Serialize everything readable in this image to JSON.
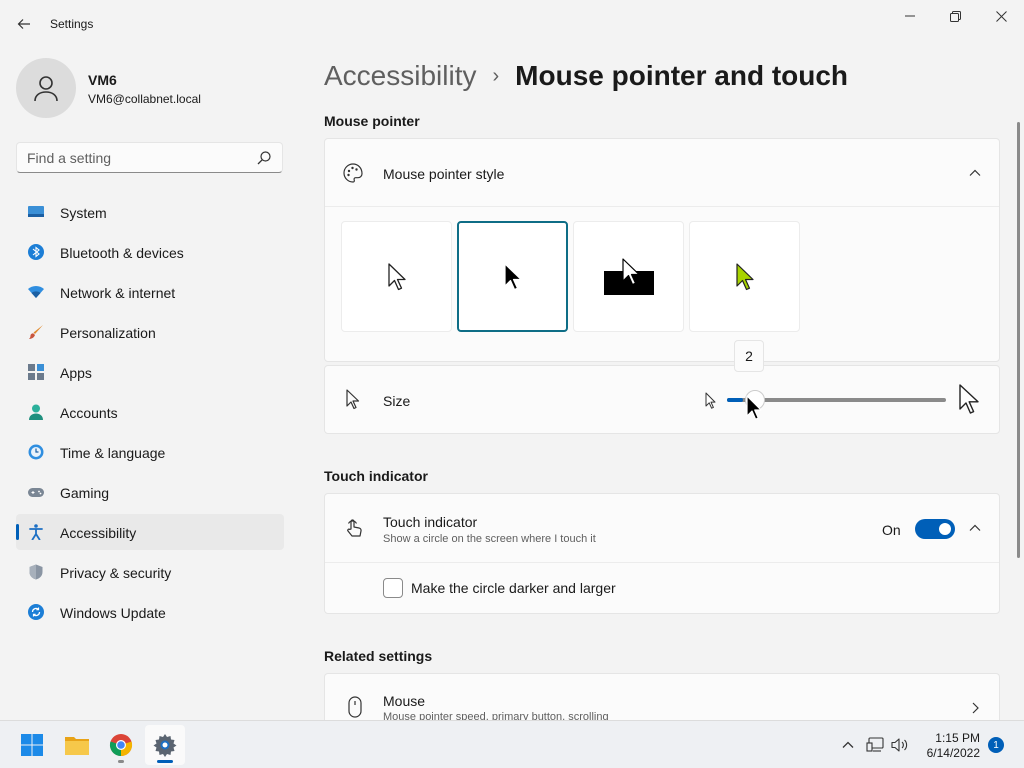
{
  "window": {
    "title": "Settings"
  },
  "profile": {
    "name": "VM6",
    "email": "VM6@collabnet.local"
  },
  "search": {
    "placeholder": "Find a setting"
  },
  "sidebar": {
    "items": [
      {
        "label": "System",
        "icon": "system-icon"
      },
      {
        "label": "Bluetooth & devices",
        "icon": "bluetooth-icon"
      },
      {
        "label": "Network & internet",
        "icon": "network-icon"
      },
      {
        "label": "Personalization",
        "icon": "brush-icon"
      },
      {
        "label": "Apps",
        "icon": "apps-icon"
      },
      {
        "label": "Accounts",
        "icon": "accounts-icon"
      },
      {
        "label": "Time & language",
        "icon": "clock-icon"
      },
      {
        "label": "Gaming",
        "icon": "gamepad-icon"
      },
      {
        "label": "Accessibility",
        "icon": "accessibility-icon",
        "selected": true
      },
      {
        "label": "Privacy & security",
        "icon": "shield-icon"
      },
      {
        "label": "Windows Update",
        "icon": "update-icon"
      }
    ]
  },
  "breadcrumb": {
    "parent": "Accessibility",
    "separator": "›",
    "current": "Mouse pointer and touch"
  },
  "mouse_pointer": {
    "section_title": "Mouse pointer",
    "style_label": "Mouse pointer style",
    "styles": [
      "white",
      "black",
      "inverted",
      "custom"
    ],
    "selected_style": "black",
    "custom_color": "#a8d400",
    "size_label": "Size",
    "size_value": 2,
    "size_min": 1,
    "size_max": 15,
    "size_tooltip": "2"
  },
  "touch_indicator": {
    "section_title": "Touch indicator",
    "label": "Touch indicator",
    "description": "Show a circle on the screen where I touch it",
    "toggle_state": "On",
    "checkbox_label": "Make the circle darker and larger",
    "checkbox_checked": false
  },
  "related": {
    "section_title": "Related settings",
    "mouse_label": "Mouse",
    "mouse_description": "Mouse pointer speed, primary button, scrolling"
  },
  "taskbar": {
    "apps": [
      "start-icon",
      "file-explorer-icon",
      "chrome-icon",
      "settings-icon"
    ],
    "time": "1:15 PM",
    "date": "6/14/2022",
    "notification_count": "1"
  },
  "colors": {
    "accent": "#005fb8",
    "selected_border": "#0e6d86"
  }
}
